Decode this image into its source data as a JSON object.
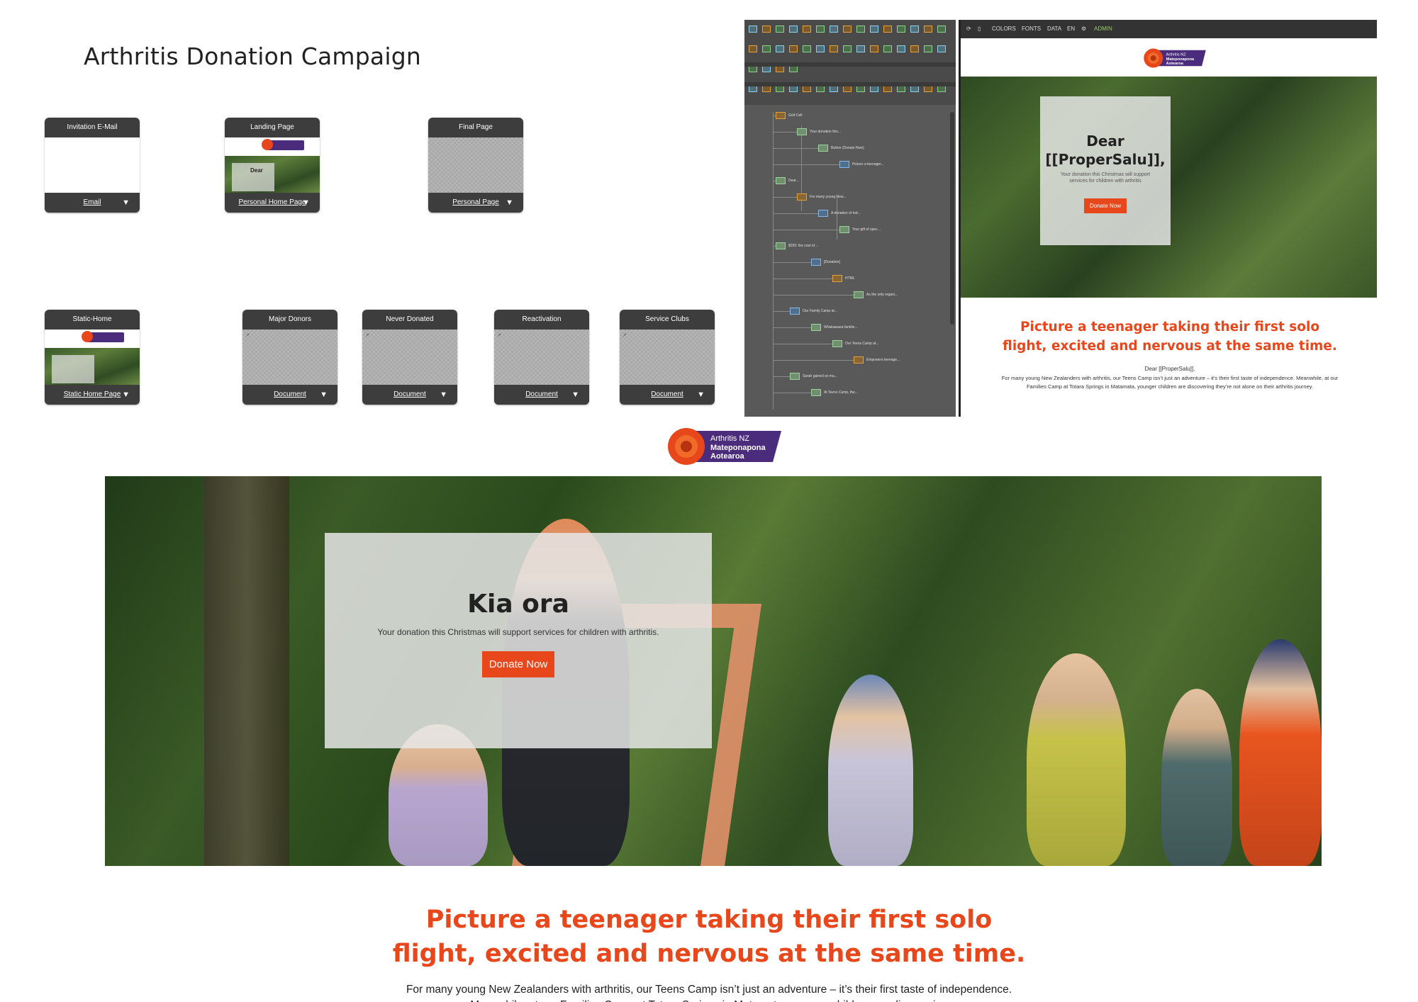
{
  "campaign": {
    "title": "Arthritis Donation Campaign"
  },
  "cards": {
    "invitation": {
      "title": "Invitation E-Mail",
      "type": "Email"
    },
    "landing": {
      "title": "Landing Page",
      "type": "Personal Home Page",
      "thumb_text": "Dear"
    },
    "final": {
      "title": "Final Page",
      "type": "Personal Page"
    },
    "static": {
      "title": "Static-Home",
      "type": "Static Home Page"
    },
    "major": {
      "title": "Major Donors",
      "type": "Document"
    },
    "never": {
      "title": "Never Donated",
      "type": "Document"
    },
    "reactivation": {
      "title": "Reactivation",
      "type": "Document"
    },
    "service": {
      "title": "Service Clubs",
      "type": "Document"
    }
  },
  "editor": {
    "nodes": [
      "Grid Cell",
      "Your donation this...",
      "Button (Donate Now)",
      "Picture a teenager...",
      "Dear...",
      "For many young New...",
      "A donation of tod...",
      "Your gift of spec...",
      "$250: the cost of...",
      "[Donation]",
      "HTML",
      "As the only organi...",
      "Our Family Camp at...",
      "Whakawaea familie...",
      "Our Teens Camp at...",
      "Empowers teenage...",
      "Sarah gained so mu...",
      "At Teens Camp, the..."
    ]
  },
  "preview": {
    "toolbar": [
      "COLORS",
      "FONTS",
      "DATA",
      "EN",
      "ADMIN"
    ],
    "logo": {
      "line1": "Arthritis NZ",
      "line2": "Mateponapona",
      "line3": "Aotearoa"
    },
    "greeting": "Dear [[ProperSalu]],",
    "subtext": "Your donation this Christmas will support services for children with arthritis",
    "button": "Donate Now",
    "headline_1": "Picture a teenager taking their first solo",
    "headline_2": "flight, excited and nervous at the same time.",
    "dear_line": "Dear [[ProperSalu]],",
    "body": "For many young New Zealanders with arthritis, our Teens Camp isn’t just an adventure – it’s their first taste of independence. Meanwhile, at our Families Camp at Totara Springs in Matamata, younger children are discovering they’re not alone on their arthritis journey."
  },
  "landing": {
    "logo": {
      "line1": "Arthritis NZ",
      "line2": "Mateponapona",
      "line3": "Aotearoa"
    },
    "card_title": "Kia ora",
    "card_sub": "Your donation this Christmas will support services for children with arthritis.",
    "button": "Donate Now",
    "headline_1": "Picture a teenager taking their first solo",
    "headline_2": "flight, excited and nervous at the same time.",
    "body": "For many young New Zealanders with arthritis, our Teens Camp isn’t just an adventure – it’s their first taste of independence. Meanwhile, at our Families Camp at Totara Springs in Matamata, younger children are discovering"
  },
  "colors": {
    "accent": "#e8471c",
    "brand_purple": "#4a2b7c",
    "card_dark": "#3d3d3d"
  }
}
